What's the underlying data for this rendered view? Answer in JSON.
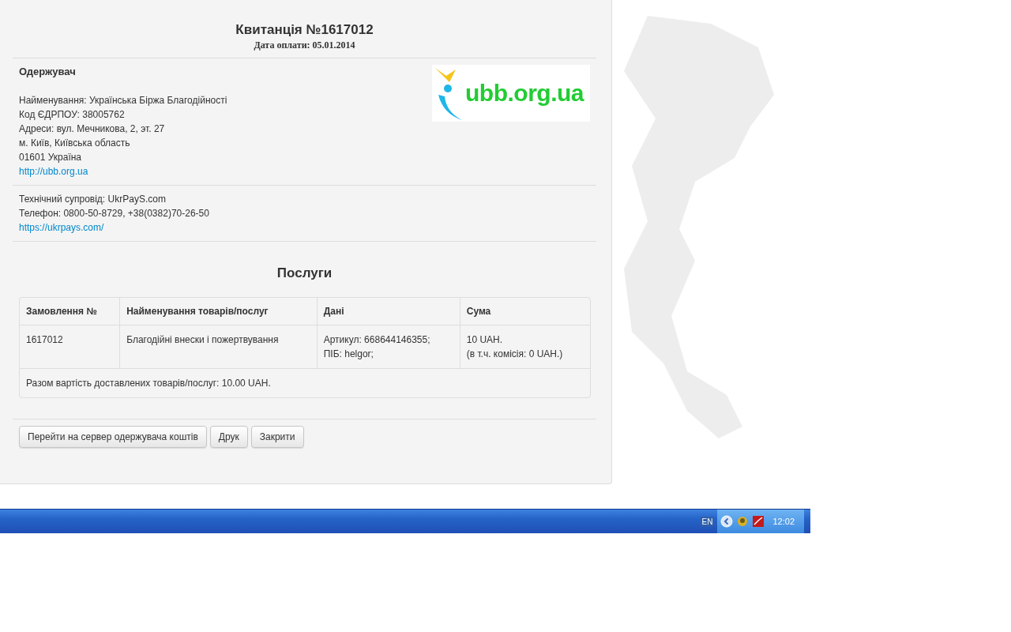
{
  "receipt": {
    "title": "Квитанція №1617012",
    "payment_date": "Дата оплати: 05.01.2014"
  },
  "recipient": {
    "heading": "Одержувач",
    "lines": [
      "Найменування: Українська Біржа Благодійності",
      "Код ЄДРПОУ: 38005762",
      "Адреси: вул. Мечникова, 2, эт. 27",
      "м. Київ, Київська область",
      "01601 Україна"
    ],
    "link": "http://ubb.org.ua",
    "logo_text": "ubb.org.ua"
  },
  "support": {
    "lines": [
      "Технічний супровід: UkrPayS.com",
      "Телефон: 0800-50-8729, +38(0382)70-26-50"
    ],
    "link": "https://ukrpays.com/"
  },
  "services": {
    "heading": "Послуги",
    "columns": [
      "Замовлення №",
      "Найменування товарів/послуг",
      "Дані",
      "Сума"
    ],
    "rows": [
      [
        [
          "1617012"
        ],
        [
          "Благодійні внески і пожертвування"
        ],
        [
          "Артикул: 668644146355;",
          "ПІБ: helgor;"
        ],
        [
          "10 UAH.",
          "(в т.ч. комісія: 0 UAH.)"
        ]
      ]
    ],
    "total": "Разом вартість доставлених товарів/послуг: 10.00 UAH."
  },
  "buttons": [
    "Перейти на сервер одержувача коштів",
    "Друк",
    "Закрити"
  ],
  "taskbar": {
    "language": "EN",
    "clock": "12:02"
  }
}
